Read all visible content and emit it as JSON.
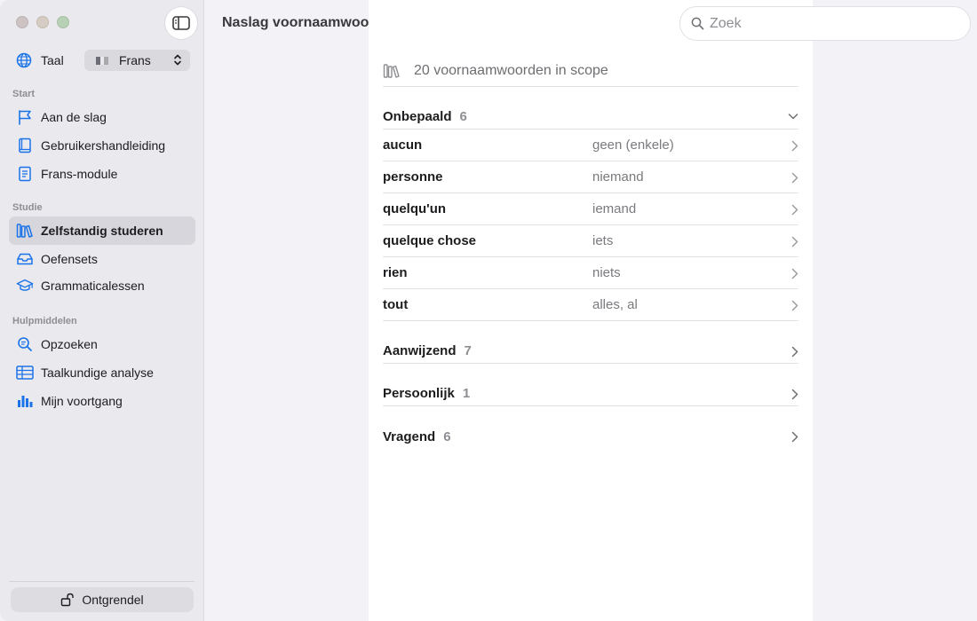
{
  "window": {
    "title": "Naslag voornaamwoorden"
  },
  "sidebar": {
    "language_label": "Taal",
    "language_value": "Frans",
    "sections": {
      "start": "Start",
      "study": "Studie",
      "tools": "Hulpmiddelen"
    },
    "items": [
      {
        "label": "Aan de slag",
        "icon": "flag-icon"
      },
      {
        "label": "Gebruikershandleiding",
        "icon": "book-icon"
      },
      {
        "label": "Frans-module",
        "icon": "document-icon"
      },
      {
        "label": "Zelfstandig studeren",
        "icon": "books-icon",
        "active": true
      },
      {
        "label": "Oefensets",
        "icon": "tray-icon"
      },
      {
        "label": "Grammaticalessen",
        "icon": "graduation-cap-icon"
      },
      {
        "label": "Opzoeken",
        "icon": "magnifier-icon"
      },
      {
        "label": "Taalkundige analyse",
        "icon": "table-icon"
      },
      {
        "label": "Mijn voortgang",
        "icon": "bar-chart-icon"
      }
    ],
    "unlock_label": "Ontgrendel"
  },
  "search": {
    "placeholder": "Zoek",
    "value": ""
  },
  "main": {
    "scope_text": "20 voornaamwoorden in scope",
    "groups": [
      {
        "name": "Onbepaald",
        "count": "6",
        "expanded": true,
        "entries": [
          {
            "term": "aucun",
            "meaning": "geen (enkele)"
          },
          {
            "term": "personne",
            "meaning": "niemand"
          },
          {
            "term": "quelqu'un",
            "meaning": "iemand"
          },
          {
            "term": "quelque chose",
            "meaning": "iets"
          },
          {
            "term": "rien",
            "meaning": "niets"
          },
          {
            "term": "tout",
            "meaning": "alles, al"
          }
        ]
      },
      {
        "name": "Aanwijzend",
        "count": "7",
        "expanded": false
      },
      {
        "name": "Persoonlijk",
        "count": "1",
        "expanded": false
      },
      {
        "name": "Vragend",
        "count": "6",
        "expanded": false
      }
    ]
  },
  "colors": {
    "accent": "#1a73e8",
    "sidebar_bg": "#e9e9ee",
    "content_bg": "#ffffff",
    "window_bg": "#f2f2f7"
  }
}
